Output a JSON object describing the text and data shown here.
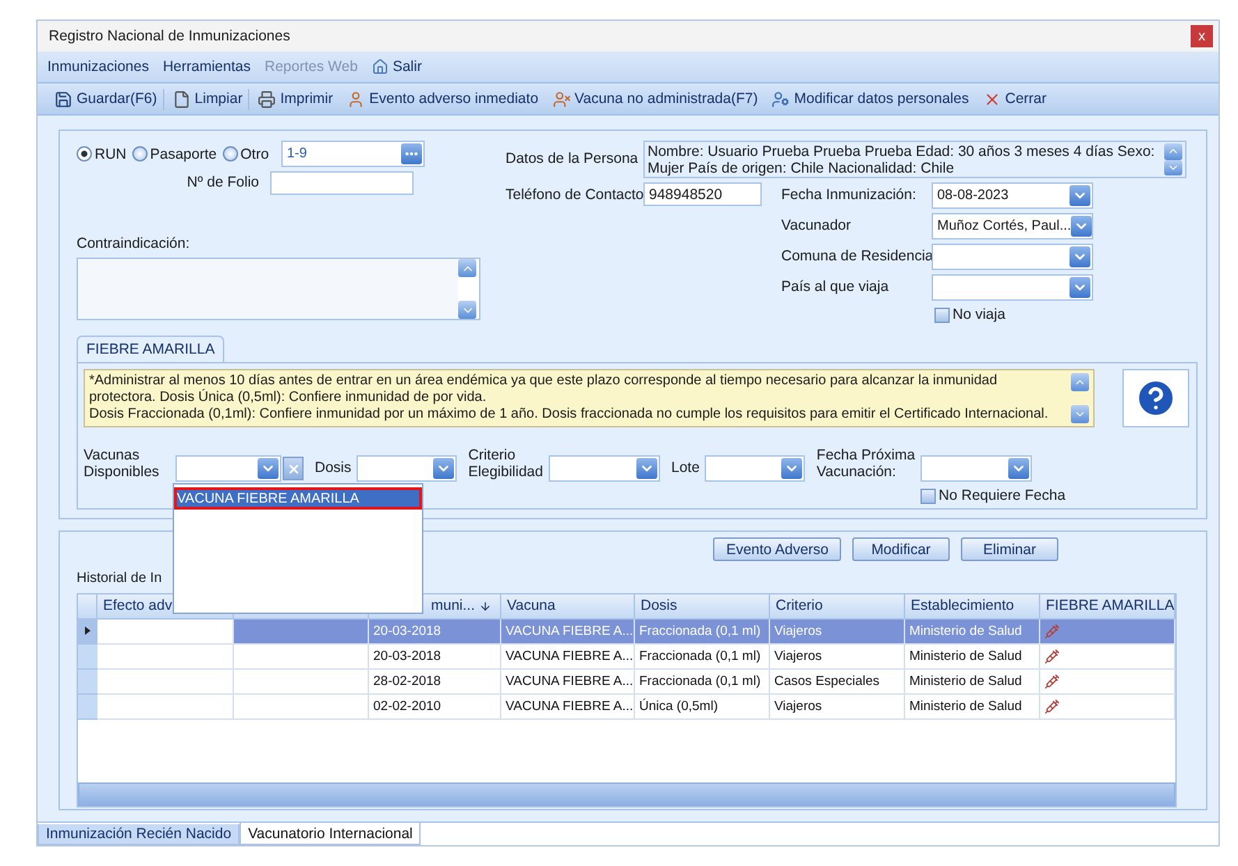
{
  "window": {
    "title": "Registro Nacional de Inmunizaciones",
    "close": "x"
  },
  "menu": [
    {
      "label": "Inmunizaciones",
      "disabled": false
    },
    {
      "label": "Herramientas",
      "disabled": false
    },
    {
      "label": "Reportes Web",
      "disabled": true
    },
    {
      "label": "Salir",
      "disabled": false
    }
  ],
  "toolbar": [
    "Guardar(F6)",
    "Limpiar",
    "Imprimir",
    "Evento adverso inmediato",
    "Vacuna no administrada(F7)",
    "Modificar datos personales",
    "Cerrar"
  ],
  "identity": {
    "options": [
      {
        "label": "RUN",
        "selected": true
      },
      {
        "label": "Pasaporte",
        "selected": false
      },
      {
        "label": "Otro",
        "selected": false
      }
    ],
    "value": "1-9",
    "folio_label": "Nº de Folio"
  },
  "person": {
    "label": "Datos de la Persona",
    "value": "Nombre: Usuario Prueba Prueba Prueba  Edad: 30 años 3 meses 4 días  Sexo: Mujer País de origen: Chile Nacionalidad: Chile",
    "phone_label": "Teléfono de Contacto",
    "phone": "948948520"
  },
  "details": [
    {
      "label": "Fecha Inmunización:",
      "value": "08-08-2023"
    },
    {
      "label": "Vacunador",
      "value": "Muñoz Cortés, Paul..."
    },
    {
      "label": "Comuna de Residencia"
    },
    {
      "label": "País al que viaja"
    }
  ],
  "no_viaja": {
    "label": "No viaja",
    "checked": false
  },
  "contraindication": {
    "label": "Contraindicación:"
  },
  "vaccine_tab": {
    "label": "FIEBRE AMARILLA",
    "selected": true,
    "info": "*Administrar al menos 10 días antes de entrar en un área endémica ya que este plazo corresponde al tiempo necesario para alcanzar la inmunidad protectora. Dosis Única (0,5ml): Confiere inmunidad de por vida.\nDosis Fraccionada (0,1ml): Confiere inmunidad por un máximo de 1 año. Dosis fraccionada no cumple los requisitos para emitir el Certificado Internacional."
  },
  "vaccine_fields": [
    {
      "kind": "combo_clear",
      "label": "Vacunas\nDisponibles"
    },
    {
      "kind": "combo",
      "label": "Dosis"
    },
    {
      "kind": "combo",
      "label": "Criterio\nElegibilidad"
    },
    {
      "kind": "combo",
      "label": "Lote"
    },
    {
      "kind": "combo",
      "label": "Fecha Próxima\nVacunación:"
    }
  ],
  "no_requiere": {
    "label": "No Requiere Fecha",
    "checked": false
  },
  "dropdown": {
    "items": [
      {
        "label": "VACUNA FIEBRE AMARILLA",
        "selected": true
      }
    ]
  },
  "buttons": [
    "Evento Adverso",
    "Modificar",
    "Eliminar"
  ],
  "history_label": "Historial de In",
  "table": {
    "columns": [
      {
        "label": "Efecto adv",
        "sorted": false
      },
      {
        "label": "muni...",
        "sorted": true
      },
      {
        "label": "Vacuna",
        "sorted": false
      },
      {
        "label": "Dosis",
        "sorted": false
      },
      {
        "label": "Criterio",
        "sorted": false
      },
      {
        "label": "Establecimiento",
        "sorted": false
      },
      {
        "label": "FIEBRE AMARILLA",
        "sorted": false
      }
    ],
    "rows": [
      {
        "selected": true,
        "fecha": "20-03-2018",
        "vacuna": "VACUNA FIEBRE A...",
        "dosis": "Fraccionada (0,1 ml)",
        "criterio": "Viajeros",
        "establecimiento": "Ministerio de Salud"
      },
      {
        "selected": false,
        "fecha": "20-03-2018",
        "vacuna": "VACUNA FIEBRE A...",
        "dosis": "Fraccionada (0,1 ml)",
        "criterio": "Viajeros",
        "establecimiento": "Ministerio de Salud"
      },
      {
        "selected": false,
        "fecha": "28-02-2018",
        "vacuna": "VACUNA FIEBRE A...",
        "dosis": "Fraccionada (0,1 ml)",
        "criterio": "Casos Especiales",
        "establecimiento": "Ministerio de Salud"
      },
      {
        "selected": false,
        "fecha": "02-02-2010",
        "vacuna": "VACUNA FIEBRE A...",
        "dosis": "Única (0,5ml)",
        "criterio": "Viajeros",
        "establecimiento": "Ministerio de Salud"
      }
    ]
  },
  "bottom_tabs": [
    {
      "label": "Inmunización Recién Nacido",
      "selected": false
    },
    {
      "label": "Vacunatorio Internacional",
      "selected": true
    }
  ]
}
